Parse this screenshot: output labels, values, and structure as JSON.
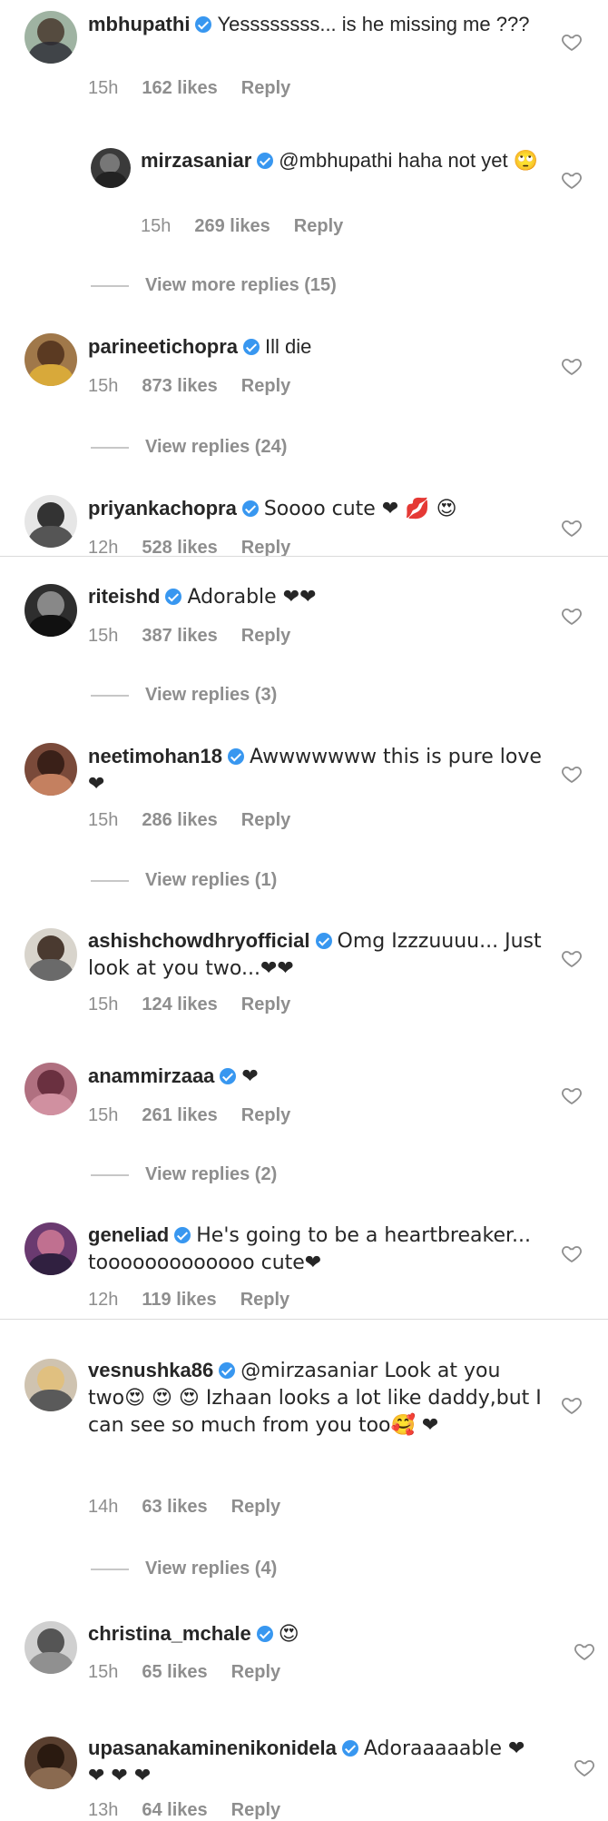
{
  "comments": [
    {
      "user": "mbhupathi",
      "text": "Yessssssss... is he missing me ???",
      "time": "15h",
      "likes": "162 likes",
      "reply": "Reply",
      "view_replies": ""
    },
    {
      "user": "mirzasaniar",
      "text": "@mbhupathi haha not yet 🙄",
      "time": "15h",
      "likes": "269 likes",
      "reply": "Reply",
      "view_replies": "View more replies (15)"
    },
    {
      "user": "parineetichopra",
      "text": "Ill die",
      "time": "15h",
      "likes": "873 likes",
      "reply": "Reply",
      "view_replies": "View replies (24)"
    },
    {
      "user": "priyankachopra",
      "text": "Soooo cute ❤ 💋 😍",
      "time": "12h",
      "likes": "528 likes",
      "reply": "Reply",
      "view_replies": ""
    },
    {
      "user": "riteishd",
      "text": "Adorable ❤❤",
      "time": "15h",
      "likes": "387 likes",
      "reply": "Reply",
      "view_replies": "View replies (3)"
    },
    {
      "user": "neetimohan18",
      "text": "Awwwwwww this is pure love ❤",
      "time": "15h",
      "likes": "286 likes",
      "reply": "Reply",
      "view_replies": "View replies (1)"
    },
    {
      "user": "ashishchowdhryofficial",
      "text": "Omg Izzzuuuu... Just look at you two...❤❤",
      "time": "15h",
      "likes": "124 likes",
      "reply": "Reply",
      "view_replies": ""
    },
    {
      "user": "anammirzaaa",
      "text": "❤",
      "time": "15h",
      "likes": "261 likes",
      "reply": "Reply",
      "view_replies": "View replies (2)"
    },
    {
      "user": "geneliad",
      "text": "He's going to be a heartbreaker... tooooooooooooo cute❤",
      "time": "12h",
      "likes": "119 likes",
      "reply": "Reply",
      "view_replies": ""
    },
    {
      "user": "vesnushka86",
      "text": "@mirzasaniar Look at you two😍 😍 😍 Izhaan looks a lot like daddy,but I can see so much from you too🥰 ❤",
      "time": "14h",
      "likes": "63 likes",
      "reply": "Reply",
      "view_replies": "View replies (4)"
    },
    {
      "user": "christina_mchale",
      "text": "😍",
      "time": "15h",
      "likes": "65 likes",
      "reply": "Reply",
      "view_replies": ""
    },
    {
      "user": "upasanakaminenikonidela",
      "text": "Adoraaaaable ❤ ❤ ❤ ❤",
      "time": "13h",
      "likes": "64 likes",
      "reply": "Reply",
      "view_replies": ""
    }
  ]
}
